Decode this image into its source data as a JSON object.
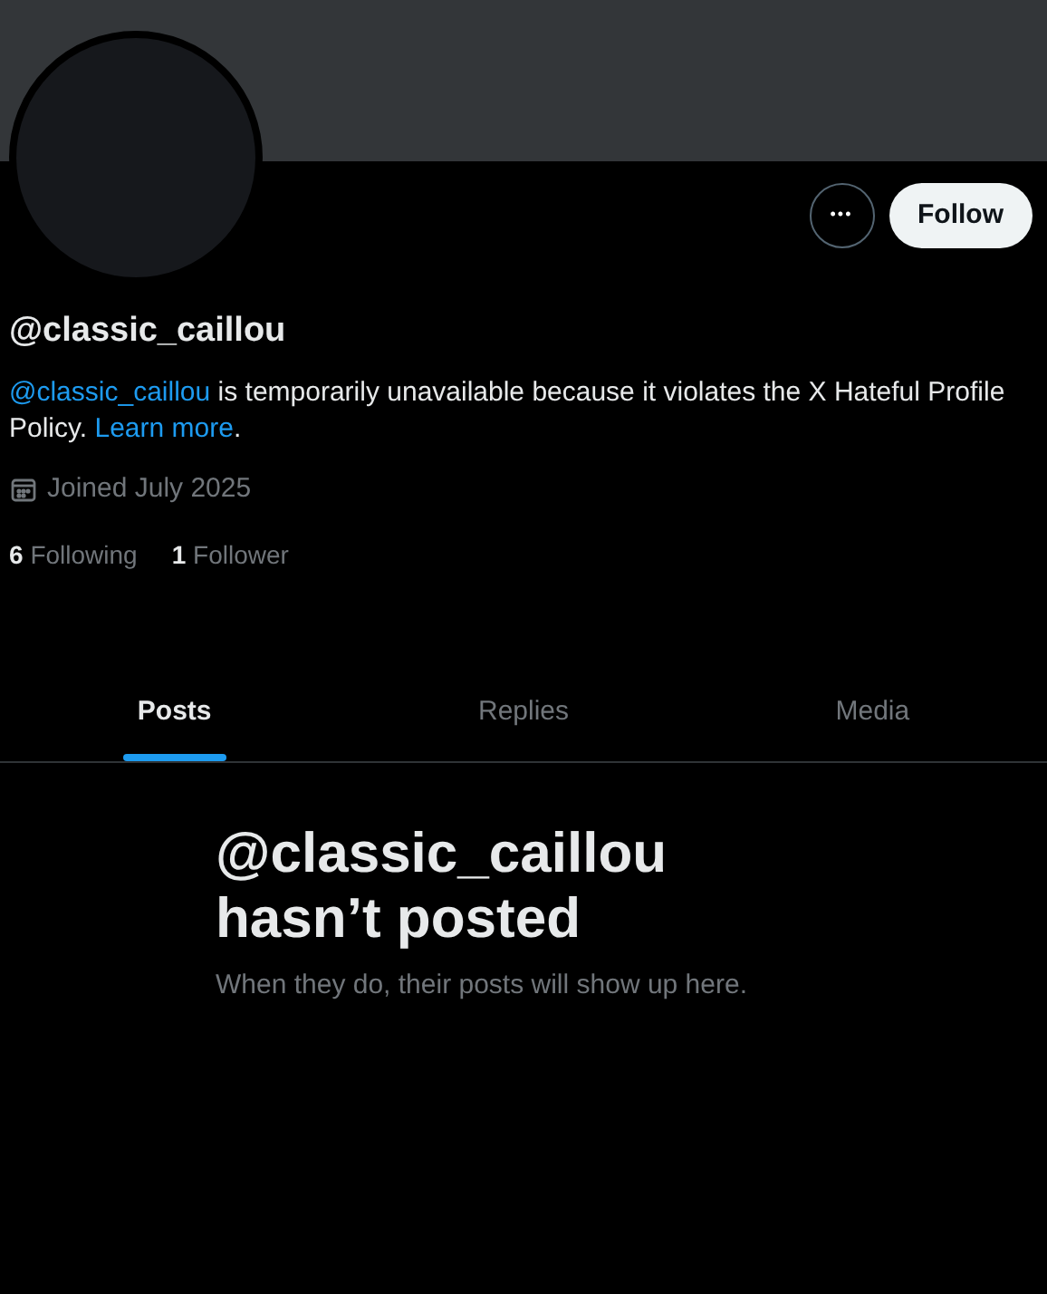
{
  "profile": {
    "follow_button": "Follow",
    "more_button": "•••",
    "handle": "@classic_caillou",
    "bio": [
      {
        "kind": "link",
        "text": "@classic_caillou"
      },
      {
        "kind": "text",
        "text": " is temporarily unavailable because it violates the X Hateful Profile Policy. "
      },
      {
        "kind": "link",
        "text": "Learn more"
      },
      {
        "kind": "text",
        "text": "."
      }
    ],
    "joined": "Joined July 2025",
    "stats": [
      {
        "count": "6",
        "label": "Following"
      },
      {
        "count": "1",
        "label": "Follower"
      }
    ]
  },
  "tabs": [
    {
      "label": "Posts",
      "selected": true
    },
    {
      "label": "Replies",
      "selected": false
    },
    {
      "label": "Media",
      "selected": false
    }
  ],
  "empty_state": {
    "title_lines": [
      "@classic_caillou",
      "hasn’t posted"
    ],
    "subtitle": "When they do, their posts will show up here."
  }
}
